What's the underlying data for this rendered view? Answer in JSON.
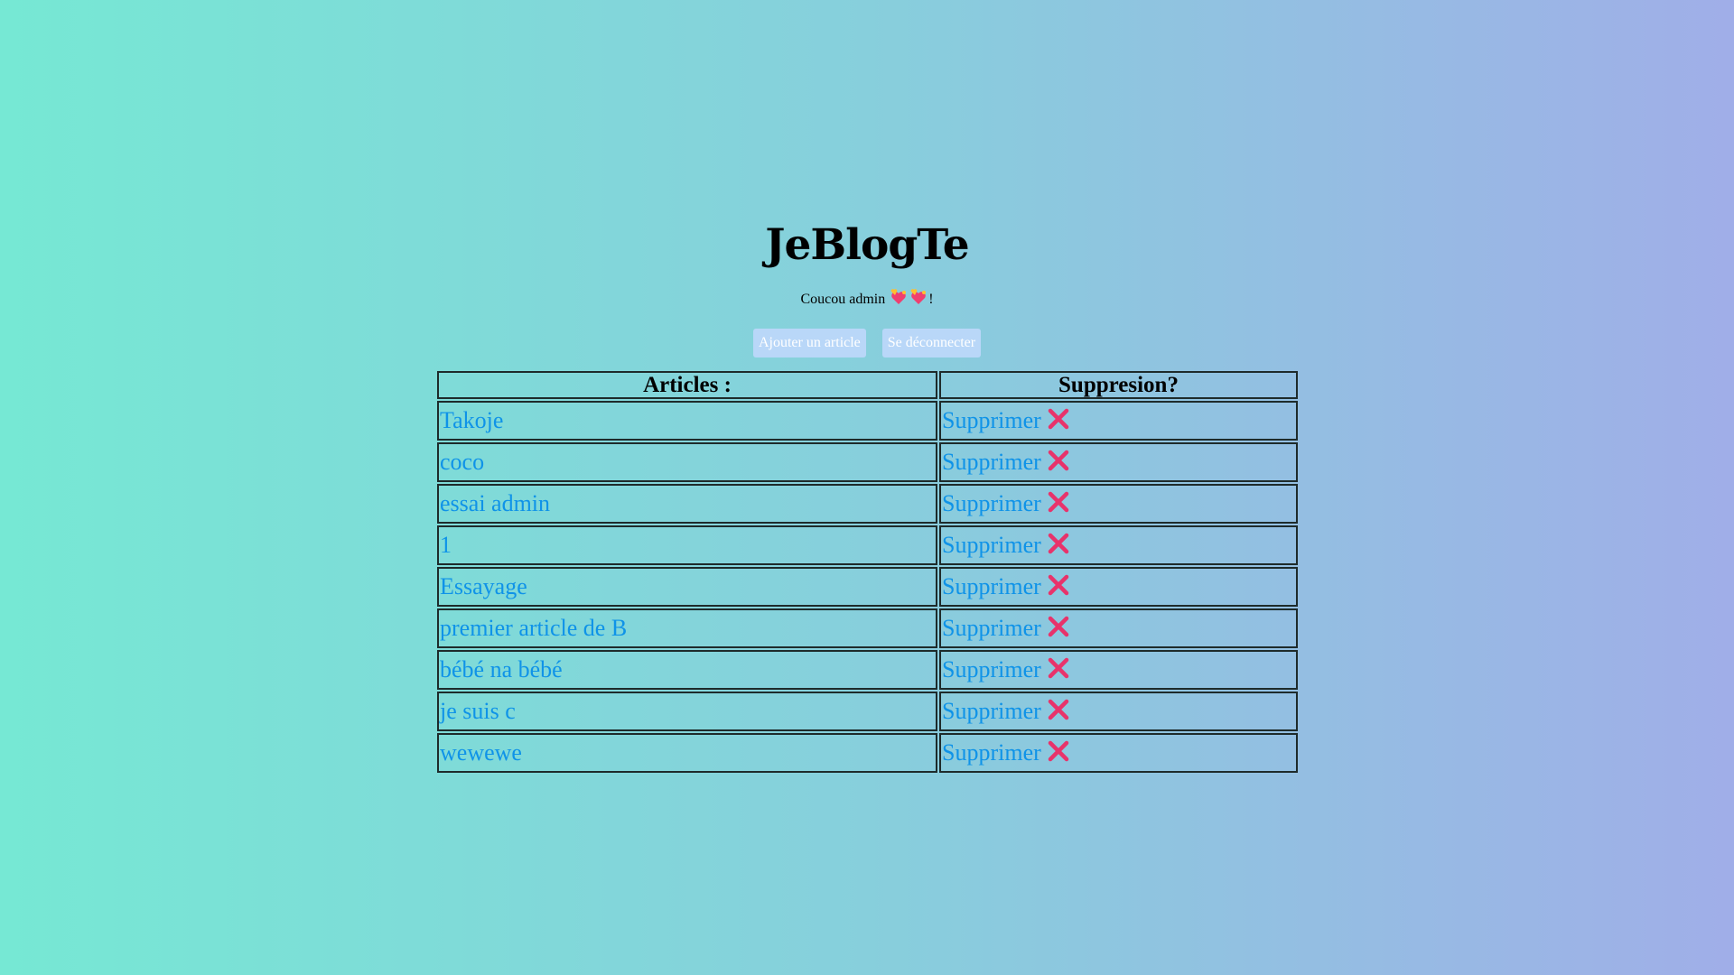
{
  "header": {
    "title": "JeBlogTe",
    "greeting_prefix": "Coucou admin",
    "greeting_suffix": "!"
  },
  "actions": {
    "add_label": "Ajouter un article",
    "logout_label": "Se déconnecter",
    "button_bg": "#b9d7f8"
  },
  "table": {
    "headers": [
      "Articles :",
      "Suppresion?"
    ],
    "rows": [
      {
        "title": "Takoje",
        "delete_label": "Supprimer"
      },
      {
        "title": "coco",
        "delete_label": "Supprimer"
      },
      {
        "title": "essai admin",
        "delete_label": "Supprimer"
      },
      {
        "title": "1",
        "delete_label": "Supprimer"
      },
      {
        "title": "Essayage",
        "delete_label": "Supprimer"
      },
      {
        "title": "premier article de B",
        "delete_label": "Supprimer"
      },
      {
        "title": "bébé na bébé",
        "delete_label": "Supprimer"
      },
      {
        "title": "je suis c",
        "delete_label": "Supprimer"
      },
      {
        "title": "wewewe",
        "delete_label": "Supprimer"
      }
    ]
  },
  "icons": {
    "greeting": [
      "hearts-icon",
      "hearts-icon"
    ],
    "delete": "cross-mark-icon"
  },
  "colors": {
    "link": "#0f93e8",
    "cross": "#e8336b",
    "gradient_start": "#76e8d4",
    "gradient_end": "#a0aee8"
  }
}
